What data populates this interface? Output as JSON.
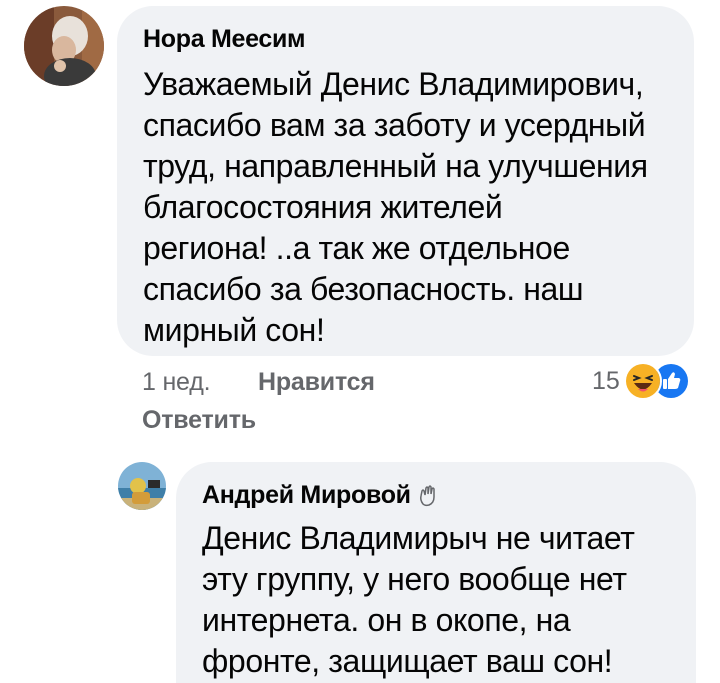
{
  "comment": {
    "author": "Нора Меесим",
    "text": "Уважаемый Денис Владимирович,\nспасибо вам за заботу и усердный\nтруд, направленный на улучшения\nблагосостояния жителей\nрегиона! ..а так же отдельное\nспасибо за безопасность. наш\nмирный сон!",
    "time": "1 нед.",
    "like_label": "Нравится",
    "reply_label": "Ответить",
    "reaction_count": "15",
    "reaction_icons": [
      "haha-icon",
      "like-icon"
    ]
  },
  "reply": {
    "author": "Андрей Мировой",
    "badge_icon": "waving-hand-icon",
    "text": "Денис Владимирыч не читает\nэту группу, у него вообще нет\nинтернета. он в окопе, на\nфронте, защищает ваш сон!"
  },
  "colors": {
    "bubble": "#f0f2f5",
    "meta_text": "#65676b",
    "like_blue": "#1877f2",
    "haha_yellow": "#f7b125"
  }
}
